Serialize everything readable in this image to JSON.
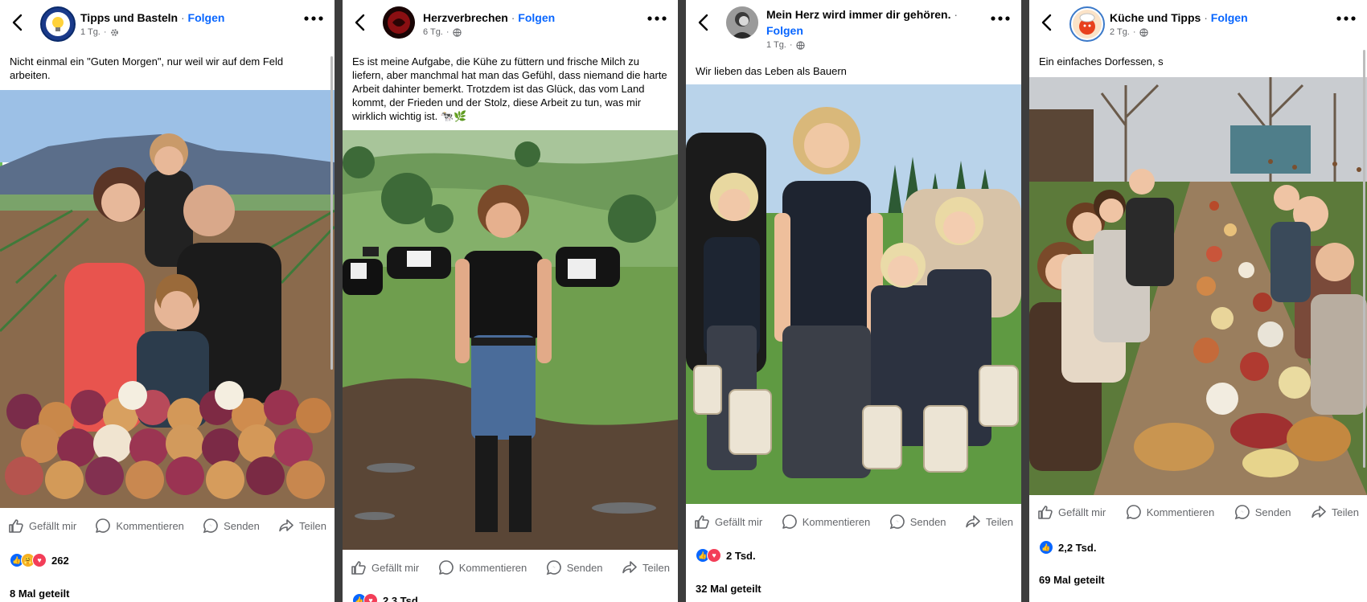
{
  "posts": [
    {
      "author": "Tipps und Basteln",
      "follow": "Folgen",
      "time": "1 Tg.",
      "caption": "Nicht einmal ein \"Guten Morgen\", nur weil wir auf dem Feld arbeiten.",
      "actions": {
        "like": "Gefällt mir",
        "comment": "Kommentieren",
        "send": "Senden",
        "share": "Teilen"
      },
      "reactions_count": "262",
      "shares": "8 Mal geteilt",
      "avatar_icon": "lightbulb-icon"
    },
    {
      "author": "Herzverbrechen",
      "follow": "Folgen",
      "time": "6 Tg.",
      "caption": "Es ist meine Aufgabe, die Kühe zu füttern und frische Milch zu liefern, aber manchmal hat man das Gefühl, dass niemand die harte Arbeit dahinter bemerkt. Trotzdem ist das Glück, das vom Land kommt, der Frieden und der Stolz, diese Arbeit zu tun, was mir wirklich wichtig ist. 🐄🌿",
      "actions": {
        "like": "Gefällt mir",
        "comment": "Kommentieren",
        "send": "Senden",
        "share": "Teilen"
      },
      "reactions_count": "2,3 Tsd.",
      "avatar_icon": "logo-icon"
    },
    {
      "author": "Mein Herz wird immer dir gehören.",
      "follow": "Folgen",
      "time": "1 Tg.",
      "caption": "Wir lieben das Leben als Bauern",
      "actions": {
        "like": "Gefällt mir",
        "comment": "Kommentieren",
        "send": "Senden",
        "share": "Teilen"
      },
      "reactions_count": "2 Tsd.",
      "shares": "32 Mal geteilt",
      "avatar_icon": "portrait-icon"
    },
    {
      "author": "Küche und Tipps",
      "follow": "Folgen",
      "time": "2 Tg.",
      "caption": "Ein einfaches Dorfessen, s",
      "actions": {
        "like": "Gefällt mir",
        "comment": "Kommentieren",
        "send": "Senden",
        "share": "Teilen"
      },
      "reactions_count": "2,2 Tsd.",
      "shares": "69 Mal geteilt",
      "avatar_icon": "chef-icon"
    }
  ],
  "colors": {
    "follow": "#0866ff",
    "highlight": "#6dbd5a",
    "divider": "#3d3d3d"
  }
}
